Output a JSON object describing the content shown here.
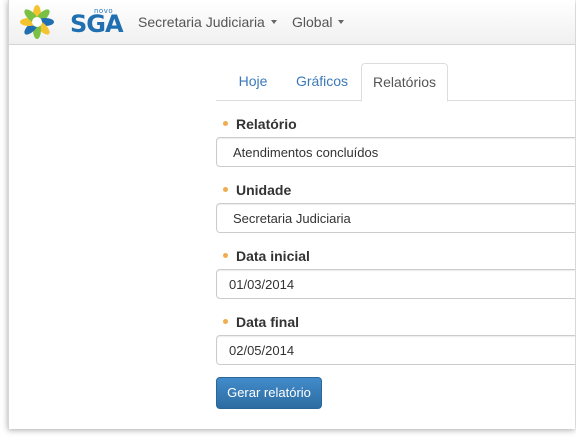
{
  "brand": {
    "small": "novo",
    "name": "SGA",
    "colors": {
      "blue": "#1f6fb1",
      "yellow": "#f4c430",
      "green": "#7ac143"
    }
  },
  "nav": {
    "items": [
      {
        "label": "Secretaria Judiciaria",
        "icon": "caret-down-icon"
      },
      {
        "label": "Global",
        "icon": "caret-down-icon"
      }
    ]
  },
  "tabs": [
    {
      "label": "Hoje",
      "active": false
    },
    {
      "label": "Gráficos",
      "active": false
    },
    {
      "label": "Relatórios",
      "active": true
    }
  ],
  "form": {
    "fields": [
      {
        "label": "Relatório",
        "value": "Atendimentos concluídos"
      },
      {
        "label": "Unidade",
        "value": "Secretaria Judiciaria"
      },
      {
        "label": "Data inicial",
        "value": "01/03/2014"
      },
      {
        "label": "Data final",
        "value": "02/05/2014"
      }
    ],
    "submit_label": "Gerar relatório"
  },
  "colors": {
    "accent": "#428bca",
    "link": "#3a7ab8",
    "required_bullet": "#f0ad4e"
  }
}
